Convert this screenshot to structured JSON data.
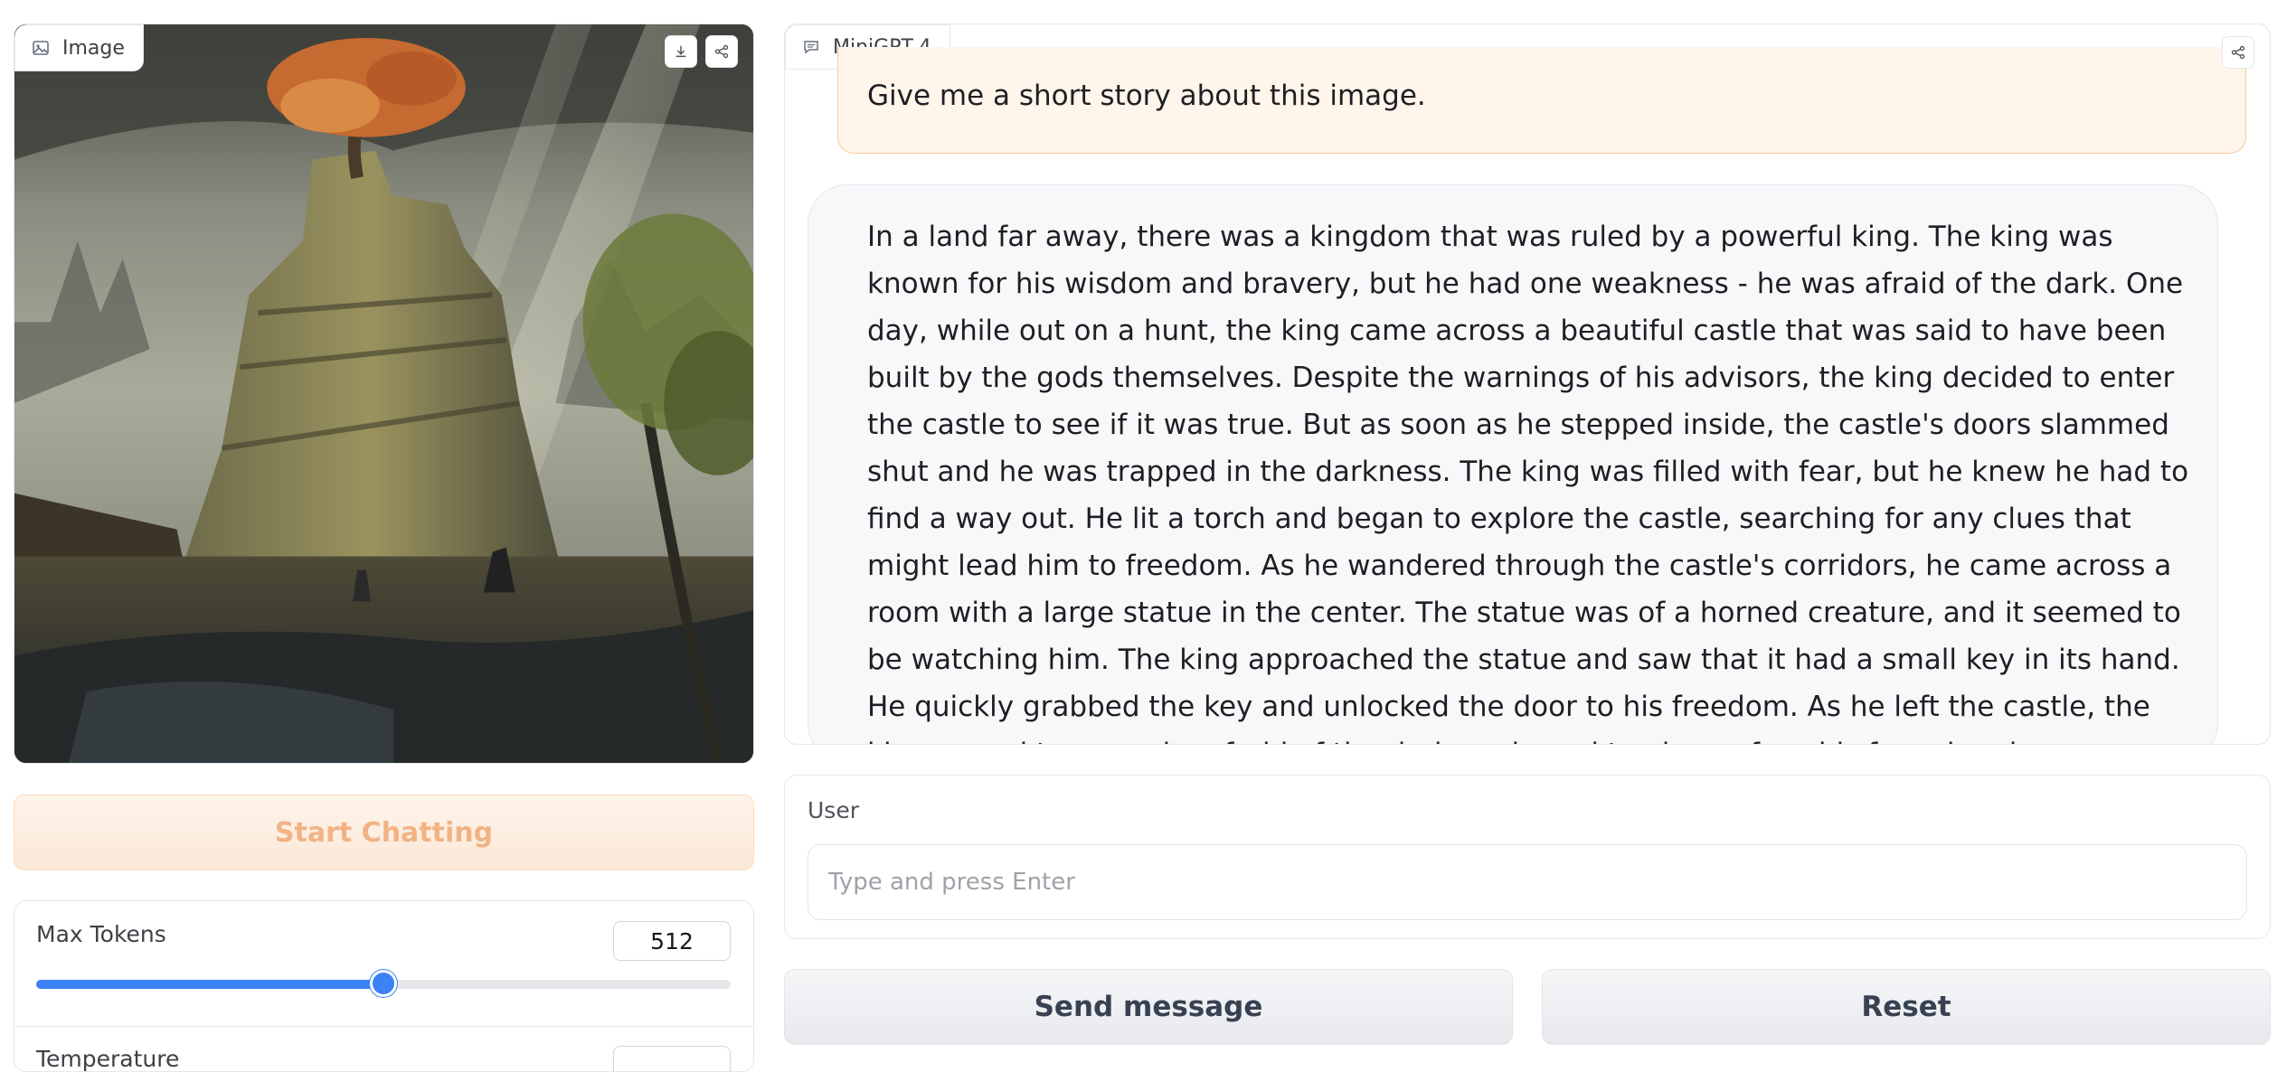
{
  "image_panel": {
    "label": "Image",
    "label_icon": "image-icon",
    "actions": [
      "download-icon",
      "share-icon"
    ]
  },
  "start_button": {
    "label": "Start Chatting"
  },
  "params": {
    "max_tokens": {
      "label": "Max Tokens",
      "value": "512",
      "slider_fraction": 0.5
    },
    "temperature": {
      "label": "Temperature"
    }
  },
  "chat": {
    "label": "MiniGPT-4",
    "label_icon": "chat-icon",
    "share_icon": "share-icon",
    "messages": [
      {
        "role": "user",
        "text": "Give me a short story about this image."
      },
      {
        "role": "bot",
        "text": "In a land far away, there was a kingdom that was ruled by a powerful king. The king was known for his wisdom and bravery, but he had one weakness - he was afraid of the dark. One day, while out on a hunt, the king came across a beautiful castle that was said to have been built by the gods themselves. Despite the warnings of his advisors, the king decided to enter the castle to see if it was true. But as soon as he stepped inside, the castle's doors slammed shut and he was trapped in the darkness. The king was filled with fear, but he knew he had to find a way out. He lit a torch and began to explore the castle, searching for any clues that might lead him to freedom. As he wandered through the castle's corridors, he came across a room with a large statue in the center. The statue was of a horned creature, and it seemed to be watching him. The king approached the statue and saw that it had a small key in its hand. He quickly grabbed the key and unlocked the door to his freedom. As he left the castle, the king vowed to never be afraid of the dark again and to always face his fears head on."
      }
    ]
  },
  "user_input": {
    "label": "User",
    "placeholder": "Type and press Enter"
  },
  "buttons": {
    "send": "Send message",
    "reset": "Reset"
  },
  "colors": {
    "accent": "#3b82f6",
    "user_bubble_bg": "#fff5eb",
    "user_bubble_border": "#f8c99b",
    "start_button_text": "#f2b384"
  }
}
